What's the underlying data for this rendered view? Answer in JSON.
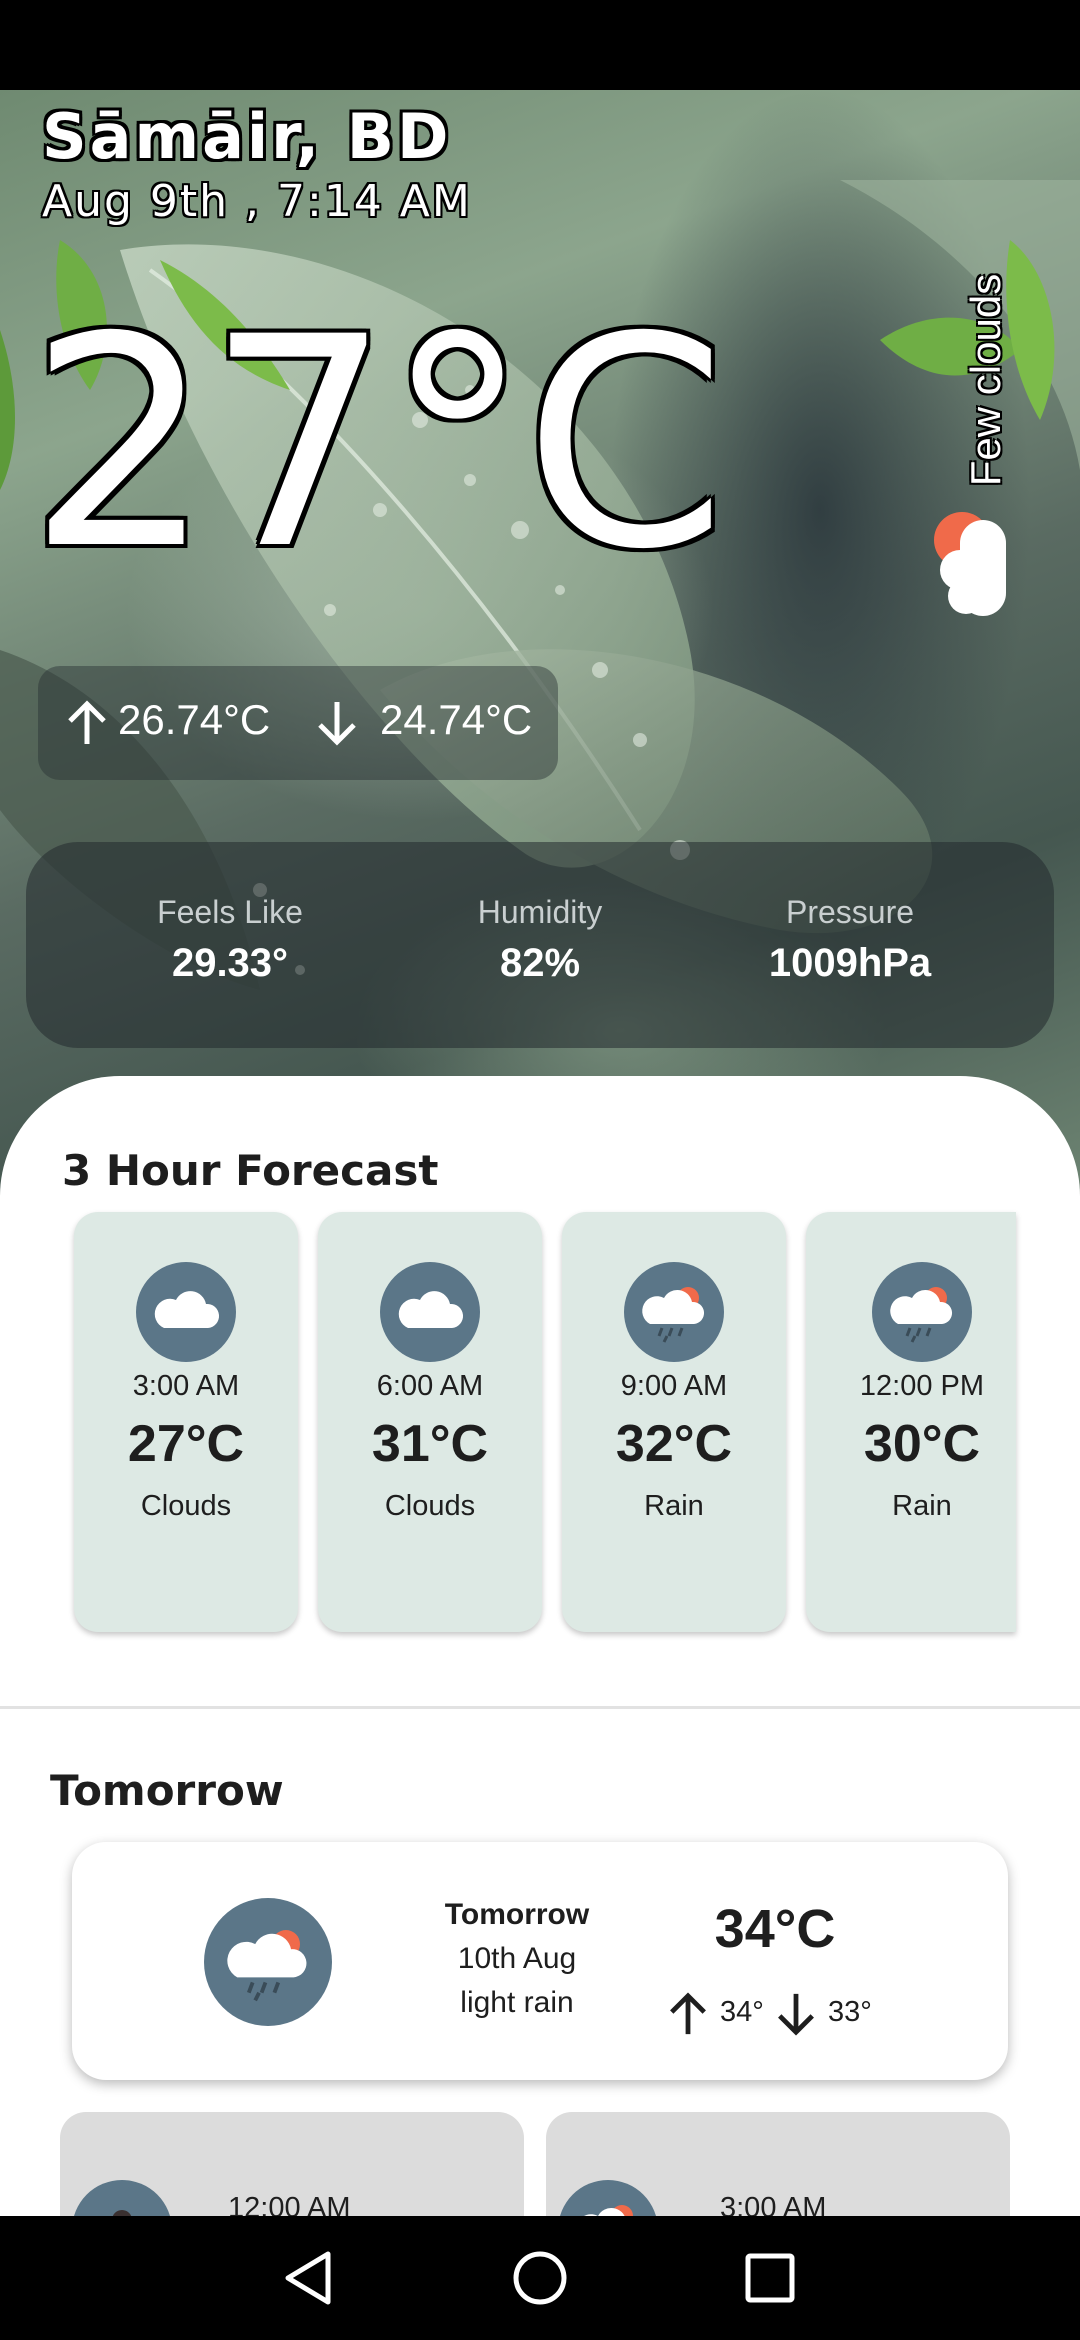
{
  "location": {
    "title": "Sāmāir, BD",
    "datetime": "Aug 9th , 7:14 AM"
  },
  "current": {
    "temperature": "27°C",
    "condition": "Few clouds",
    "condition_icon": "few-clouds-icon",
    "high": "26.74°C",
    "low": "24.74°C"
  },
  "stats": [
    {
      "label": "Feels Like",
      "value": "29.33°"
    },
    {
      "label": "Humidity",
      "value": "82%"
    },
    {
      "label": "Pressure",
      "value": "1009hPa"
    }
  ],
  "forecast": {
    "title": "3 Hour Forecast",
    "items": [
      {
        "time": "3:00 AM",
        "temp": "27°C",
        "condition": "Clouds",
        "icon": "cloud-icon"
      },
      {
        "time": "6:00 AM",
        "temp": "31°C",
        "condition": "Clouds",
        "icon": "cloud-icon"
      },
      {
        "time": "9:00 AM",
        "temp": "32°C",
        "condition": "Rain",
        "icon": "rain-sun-icon"
      },
      {
        "time": "12:00 PM",
        "temp": "30°C",
        "condition": "Rain",
        "icon": "rain-sun-icon"
      }
    ]
  },
  "tomorrow": {
    "section_title": "Tomorrow",
    "label": "Tomorrow",
    "date": "10th Aug",
    "description": "light rain",
    "temp": "34°C",
    "high": "34°",
    "low": "33°",
    "icon": "rain-sun-icon",
    "hourly": [
      {
        "time": "12:00 AM"
      },
      {
        "time": "3:00 AM"
      }
    ]
  },
  "colors": {
    "accent_sun": "#f06a4a",
    "icon_bg": "#5b7688",
    "card_bg": "#dde9e4"
  }
}
